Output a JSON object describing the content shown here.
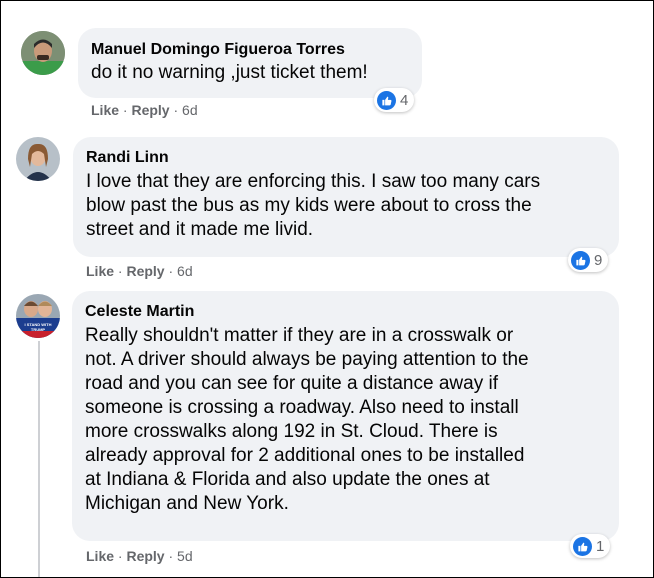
{
  "comments": [
    {
      "author": "Manuel Domingo Figueroa Torres",
      "text": "do it no warning ,just ticket them!",
      "like_label": "Like",
      "reply_label": "Reply",
      "age": "6d",
      "reaction_count": "4",
      "reaction_icon": "like-icon"
    },
    {
      "author": "Randi Linn",
      "text_lines": [
        "I love that they are enforcing this. I saw too many cars",
        "blow past the bus as my kids were about to cross the",
        "street and it made me livid."
      ],
      "like_label": "Like",
      "reply_label": "Reply",
      "age": "6d",
      "reaction_count": "9",
      "reaction_icon": "like-icon"
    },
    {
      "author": "Celeste Martin",
      "text_lines": [
        "Really shouldn't matter if they are in a crosswalk or",
        "not. A driver should always be paying attention to the",
        "road and you can see for quite a distance away if",
        "someone is crossing a roadway. Also need to install",
        "more crosswalks along 192 in St. Cloud. There is",
        "already approval for 2 additional ones to be installed",
        "at Indiana & Florida and also update the ones at",
        "Michigan and New York."
      ],
      "like_label": "Like",
      "reply_label": "Reply",
      "age": "5d",
      "reaction_count": "1",
      "reaction_icon": "like-icon",
      "avatar_badge": "I STAND WITH TRUMP"
    }
  ],
  "colors": {
    "bubble": "#f0f2f5",
    "meta_text": "#65676b",
    "like_blue": "#1b74e4"
  }
}
